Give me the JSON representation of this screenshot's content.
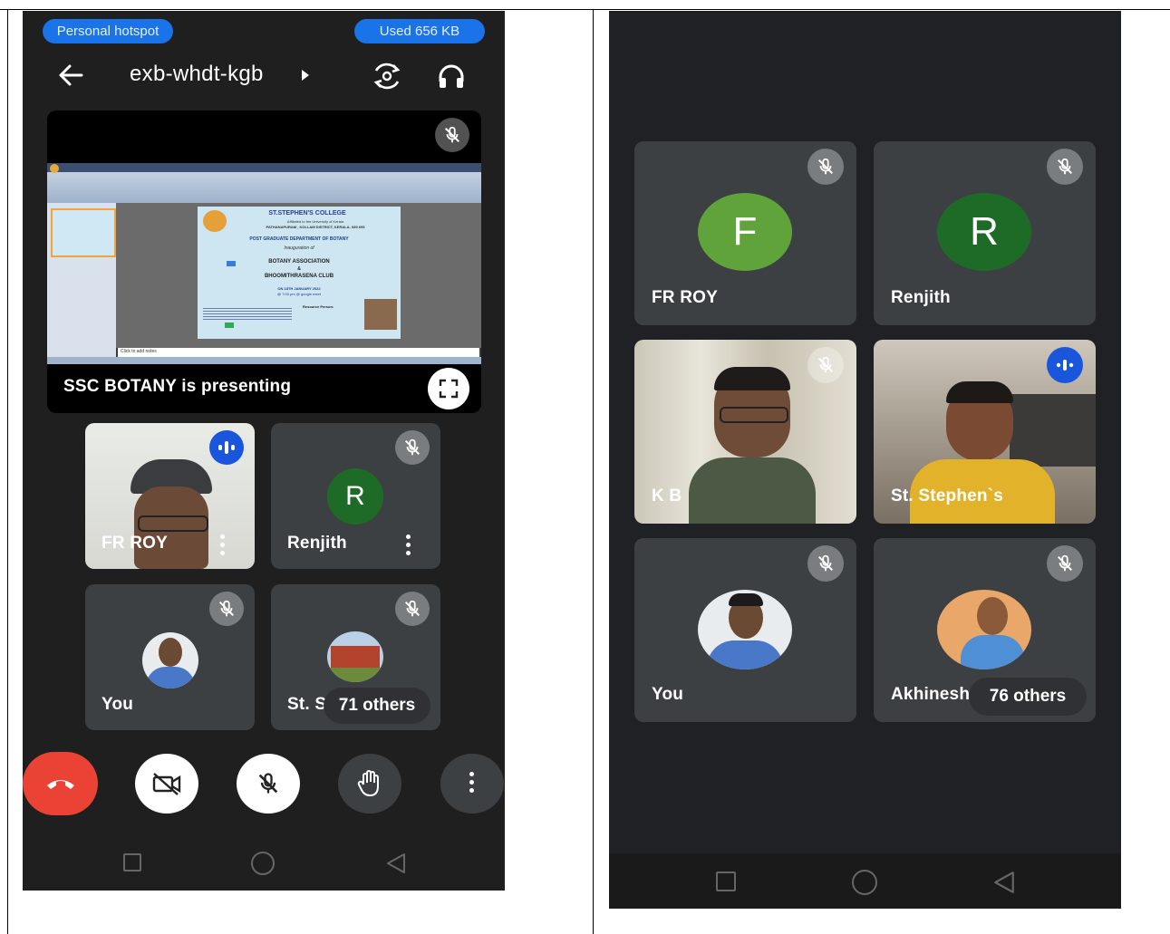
{
  "left_phone": {
    "status": {
      "hotspot_label": "Personal hotspot",
      "data_used": "Used  656 KB"
    },
    "header": {
      "meeting_code": "exb-whdt-kgb"
    },
    "presentation": {
      "presenting_text": "SSC BOTANY is presenting",
      "slide": {
        "college": "ST.STEPHEN'S COLLEGE",
        "affiliation": "Affiliated to the University of Kerala",
        "address": "PATHANAPURAM , KOLLAM DISTRICT, KERALA- 689 695",
        "department": "POST GRADUATE DEPARTMENT OF BOTANY",
        "inauguration": "Inauguration of",
        "assoc": "BOTANY ASSOCIATION",
        "amp": "&",
        "club": "BHOOMITHRASENA CLUB",
        "date": "ON 18TH JANUARY 2022",
        "time": "@ 7:00 pm @ google meet",
        "resource": "Resource Person:",
        "notes": "Click to add notes"
      }
    },
    "tiles": [
      {
        "name": "FR ROY"
      },
      {
        "name": "Renjith",
        "initial": "R"
      },
      {
        "name": "You"
      },
      {
        "name": "St. Stephen's",
        "others": "71 others"
      }
    ]
  },
  "right_phone": {
    "tiles": [
      {
        "name": "FR ROY",
        "initial": "F"
      },
      {
        "name": "Renjith",
        "initial": "R"
      },
      {
        "name": "K B"
      },
      {
        "name": "St. Stephen`s"
      },
      {
        "name": "You"
      },
      {
        "name": "Akhinesh",
        "others": "76 others"
      }
    ]
  },
  "colors": {
    "meet_bg": "#202124",
    "tile_bg": "#3c4043",
    "accent_blue": "#1a73e8",
    "end_call_red": "#ea4335",
    "avatar_green_light": "#5fa33a",
    "avatar_green_dark": "#1e6b28"
  },
  "icons": [
    "back-arrow-icon",
    "play-triangle-icon",
    "switch-camera-icon",
    "headphones-icon",
    "mic-off-icon",
    "fullscreen-icon",
    "speaking-indicator-icon",
    "more-vert-icon",
    "end-call-icon",
    "video-off-icon",
    "raise-hand-icon",
    "nav-square-icon",
    "nav-circle-icon",
    "nav-back-icon"
  ]
}
